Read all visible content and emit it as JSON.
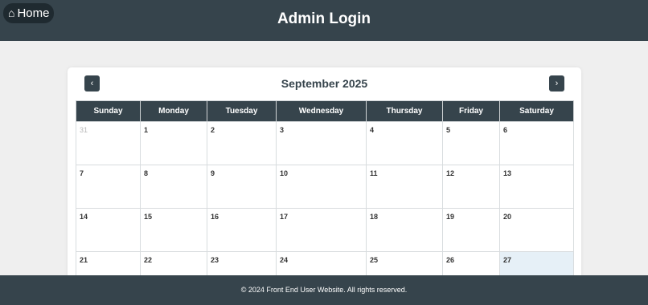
{
  "header": {
    "home_icon": "⌂",
    "home_label": "Home",
    "title": "Admin Login"
  },
  "calendar": {
    "prev_label": "‹",
    "next_label": "›",
    "month_title": "September 2025",
    "weekdays": [
      "Sunday",
      "Monday",
      "Tuesday",
      "Wednesday",
      "Thursday",
      "Friday",
      "Saturday"
    ],
    "weeks": [
      [
        {
          "day": "31",
          "other": true
        },
        {
          "day": "1"
        },
        {
          "day": "2"
        },
        {
          "day": "3"
        },
        {
          "day": "4"
        },
        {
          "day": "5"
        },
        {
          "day": "6"
        }
      ],
      [
        {
          "day": "7"
        },
        {
          "day": "8"
        },
        {
          "day": "9"
        },
        {
          "day": "10"
        },
        {
          "day": "11"
        },
        {
          "day": "12"
        },
        {
          "day": "13"
        }
      ],
      [
        {
          "day": "14"
        },
        {
          "day": "15"
        },
        {
          "day": "16"
        },
        {
          "day": "17"
        },
        {
          "day": "18"
        },
        {
          "day": "19"
        },
        {
          "day": "20"
        }
      ],
      [
        {
          "day": "21"
        },
        {
          "day": "22"
        },
        {
          "day": "23"
        },
        {
          "day": "24"
        },
        {
          "day": "25"
        },
        {
          "day": "26"
        },
        {
          "day": "27",
          "today": true
        }
      ]
    ]
  },
  "footer": {
    "text": "© 2024 Front End User Website. All rights reserved."
  },
  "colors": {
    "header_bg": "#36444c",
    "today_bg": "#e6f0f7"
  }
}
